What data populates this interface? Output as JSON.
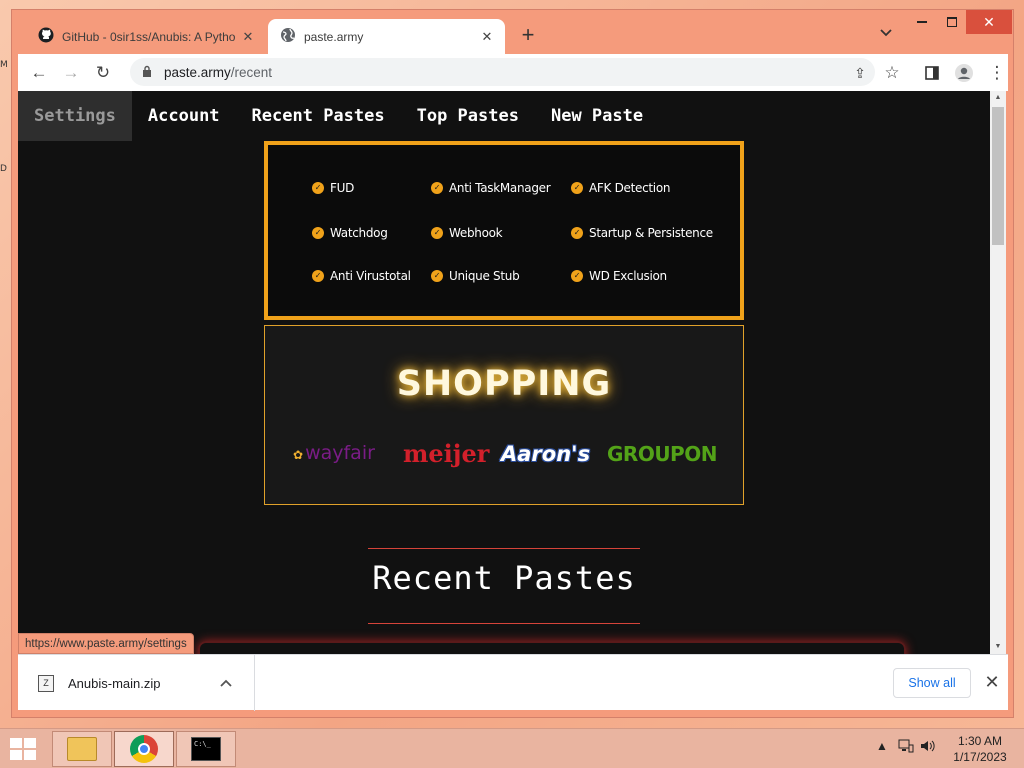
{
  "browser": {
    "tabs": [
      {
        "title": "GitHub - 0sir1ss/Anubis: A Pytho",
        "icon": "github-icon"
      },
      {
        "title": "paste.army",
        "icon": "globe-icon"
      }
    ],
    "address": {
      "host": "paste.army",
      "path": "/recent"
    },
    "status_url": "https://www.paste.army/settings"
  },
  "site": {
    "nav": [
      "Settings",
      "Account",
      "Recent Pastes",
      "Top Pastes",
      "New Paste"
    ],
    "features": [
      "FUD",
      "Anti TaskManager",
      "AFK Detection",
      "Watchdog",
      "Webhook",
      "Startup & Persistence",
      "Anti Virustotal",
      "Unique Stub",
      "WD Exclusion"
    ],
    "ad": {
      "title": "SHOPPING",
      "brands": [
        "wayfair",
        "meijer",
        "Aaron's",
        "GROUPON"
      ]
    },
    "section_title": "Recent Pastes"
  },
  "downloads": {
    "file": "Anubis-main.zip",
    "show_all": "Show all"
  },
  "taskbar": {
    "time": "1:30 AM",
    "date": "1/17/2023"
  },
  "colors": {
    "accent": "#f0a21a",
    "page_bg": "#111111",
    "red_line": "#d6443a"
  }
}
